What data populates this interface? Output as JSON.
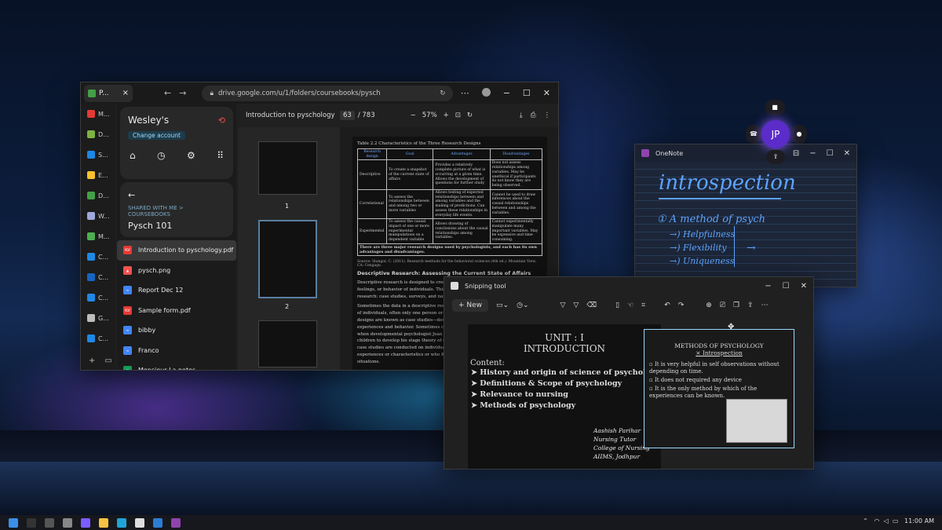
{
  "browser": {
    "tab_title": "P...",
    "url": "drive.google.com/u/1/folders/coursebooks/pysch",
    "side_tabs": [
      {
        "label": "M...",
        "color": "#e53935"
      },
      {
        "label": "D...",
        "color": "#7cb342"
      },
      {
        "label": "S...",
        "color": "#1e88e5"
      },
      {
        "label": "E...",
        "color": "#fbc02d"
      },
      {
        "label": "D...",
        "color": "#43a047"
      },
      {
        "label": "W...",
        "color": "#9fa8da"
      },
      {
        "label": "M...",
        "color": "#4caf50"
      },
      {
        "label": "C...",
        "color": "#1e88e5"
      },
      {
        "label": "C...",
        "color": "#1565c0"
      },
      {
        "label": "C...",
        "color": "#1e88e5"
      },
      {
        "label": "G...",
        "color": "#bdbdbd"
      },
      {
        "label": "C...",
        "color": "#1e88e5"
      }
    ]
  },
  "drive": {
    "account": "Wesley's",
    "change_account": "Change account",
    "breadcrumb": "SHARED WITH ME  >  COURSEBOOKS",
    "folder": "Pysch 101",
    "files": [
      {
        "name": "Introduction to pyschology.pdf",
        "type": "pdf"
      },
      {
        "name": "pysch.png",
        "type": "img"
      },
      {
        "name": "Report Dec 12",
        "type": "doc"
      },
      {
        "name": "Sample form.pdf",
        "type": "pdf"
      },
      {
        "name": "bibby",
        "type": "doc"
      },
      {
        "name": "Franco",
        "type": "doc"
      },
      {
        "name": "Monsieur La notes",
        "type": "sheet"
      }
    ]
  },
  "pdf": {
    "title": "Introduction to pyschology",
    "page": "63",
    "total": "/ 783",
    "zoom": "57%",
    "thumb_labels": [
      "1",
      "2"
    ],
    "table_caption": "Table 2.2 Characteristics of the Three Research Designs",
    "table_headers": [
      "Research design",
      "Goal",
      "Advantages",
      "Disadvantages"
    ],
    "table_rows": [
      [
        "Descriptive",
        "To create a snapshot of the current state of affairs",
        "Provides a relatively complete picture of what is occurring at a given time. Allows the development of questions for further study",
        "Does not assess relationships among variables. May be unethical if participants do not know they are being observed."
      ],
      [
        "Correlational",
        "To assess the relationships between and among two or more variables",
        "Allows testing of expected relationships between and among variables and the making of predictions. Can assess these relationships in everyday life events.",
        "Cannot be used to draw inferences about the causal relationships between and among the variables."
      ],
      [
        "Experimental",
        "To assess the causal impact of one or more experimental manipulations on a dependent variable",
        "Allows drawing of conclusions about the causal relationships among variables.",
        "Cannot experimentally manipulate many important variables. May be expensive and time consuming."
      ]
    ],
    "table_footer": "There are three major research designs used by psychologists, and each has its own advantages and disadvantages.",
    "source": "Source: Stangor, C. (2011). Research methods for the behavioral sciences (4th ed.). Mountain View, CA: Cengage.",
    "heading": "Descriptive Research: Assessing the Current State of Affairs",
    "para1": "Descriptive research is designed to create a snapshot of the current thoughts, feelings, or behavior of individuals. This section reviews three types of descriptive research: case studies, surveys, and naturalistic observation.",
    "para2": "Sometimes the data in a descriptive research project are based on only a small set of individuals, often only one person or a single small group. These research designs are known as case studies—descriptive records of one or more individual's experiences and behavior. Sometimes case studies involve ordinary individuals, as when developmental psychologist Jean Piaget used his observation of his own children to develop his stage theory of cognitive development. More frequently, case studies are conducted on individuals who have unusual or abnormal experiences or characteristics or who find themselves in particularly difficult situations."
  },
  "onenote": {
    "title": "OneNote",
    "heading": "introspection",
    "line1": "① A method of psych",
    "items": [
      "→) Helpfulness",
      "→) Flexibility",
      "→) Uniqueness"
    ]
  },
  "call": {
    "initials": "JP"
  },
  "snip": {
    "title": "Snipping tool",
    "new_label": "New",
    "slide_left": {
      "title1": "UNIT : I",
      "title2": "INTRODUCTION",
      "content_label": "Content:",
      "bullets": [
        "History and origin of science of psychology",
        "Definitions & Scope of psychology",
        "Relevance to nursing",
        "Methods of psychology"
      ],
      "author": [
        "Aashish Parihar",
        "Nursing Tutor",
        "College of Nursing",
        "AIIMS, Jodhpur"
      ]
    },
    "slide_right": {
      "title": "METHODS OF PSYCHOLOGY",
      "subtitle": "× Introspection",
      "bullets": [
        "It is very helpful in self observations without depending on time.",
        "It does not required any device",
        "It is the only method by which of the experiences can be known."
      ]
    }
  },
  "taskbar": {
    "time": "11:00 AM"
  }
}
